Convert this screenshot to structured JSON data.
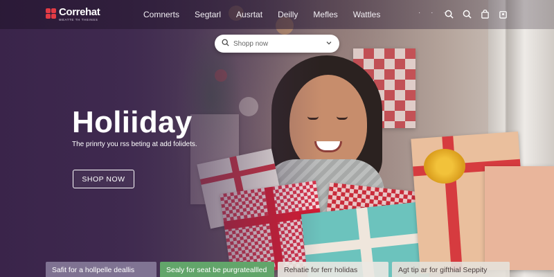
{
  "brand": {
    "name": "Correhat",
    "tagline": "WEATTE TH THEINSS",
    "accent_color": "#e23b45"
  },
  "nav": {
    "items": [
      "Comnerts",
      "Segtarl",
      "Ausrtat",
      "Deilly",
      "Mefles",
      "Wattles"
    ],
    "more_dots": "· · ·",
    "icons": [
      "search-icon",
      "zoom-icon",
      "bag-icon",
      "cart-icon"
    ]
  },
  "search": {
    "placeholder": "Shopp now",
    "icon": "search-icon",
    "dropdown_icon": "chevron-down-icon"
  },
  "hero": {
    "title": "Holiiday",
    "subtitle": "The prinrty you rss beting at add folidets.",
    "cta_label": "SHOP NOW"
  },
  "promos": [
    "Safit for a hollpelle deallis",
    "Sealy for seat be purgrateallled",
    "Rehatie for ferr holidas",
    "Agt tip ar for gifthial Seppity"
  ]
}
